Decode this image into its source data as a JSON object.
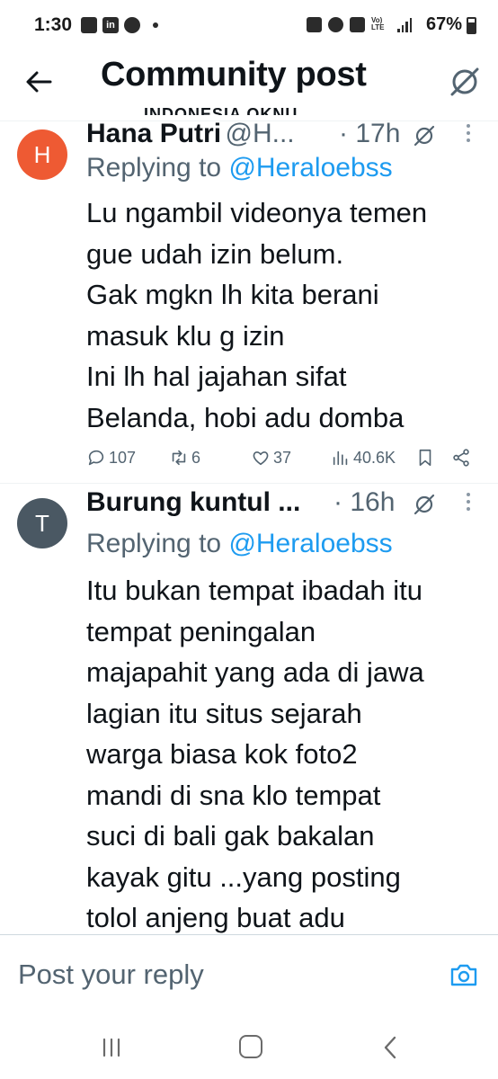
{
  "status_bar": {
    "time": "1:30",
    "battery": "67%",
    "network_label": "Vo) LTE 4G+"
  },
  "header": {
    "title": "Community post",
    "subtitle_peek": "INDONESIA OKNU"
  },
  "posts": [
    {
      "avatar_letter": "H",
      "avatar_color": "#ee5a33",
      "display_name": "Hana Putri",
      "handle": "@H...",
      "timestamp": "· 17h",
      "replying_to_prefix": "Replying to",
      "replying_to_handle": "@Heraloebss",
      "lines": [
        "Lu ngambil videonya temen",
        "gue udah izin belum.",
        "Gak mgkn lh kita berani",
        "masuk klu g izin",
        "Ini lh hal jajahan sifat",
        "Belanda, hobi adu domba"
      ],
      "replies": "107",
      "reposts": "6",
      "likes": "37",
      "views": "40.6K"
    },
    {
      "avatar_letter": "T",
      "avatar_color": "#4a5863",
      "display_name": "Burung kuntul ...",
      "handle": "",
      "timestamp": "· 16h",
      "replying_to_prefix": "Replying to",
      "replying_to_handle": "@Heraloebss",
      "lines": [
        "Itu bukan tempat ibadah itu",
        "tempat peningalan",
        "majapahit yang ada di jawa",
        "lagian itu situs sejarah",
        "warga biasa kok foto2",
        "mandi di sna klo tempat",
        "suci di bali gak bakalan",
        "kayak gitu ...yang posting",
        "tolol anjeng buat adu"
      ]
    }
  ],
  "composer": {
    "placeholder": "Post your reply"
  },
  "colors": {
    "accent": "#1d9bf0",
    "secondary_text": "#536471",
    "primary_text": "#0f1419"
  },
  "icons": {
    "back": "back-arrow-icon",
    "grok": "grok-icon",
    "camera": "camera-icon"
  }
}
